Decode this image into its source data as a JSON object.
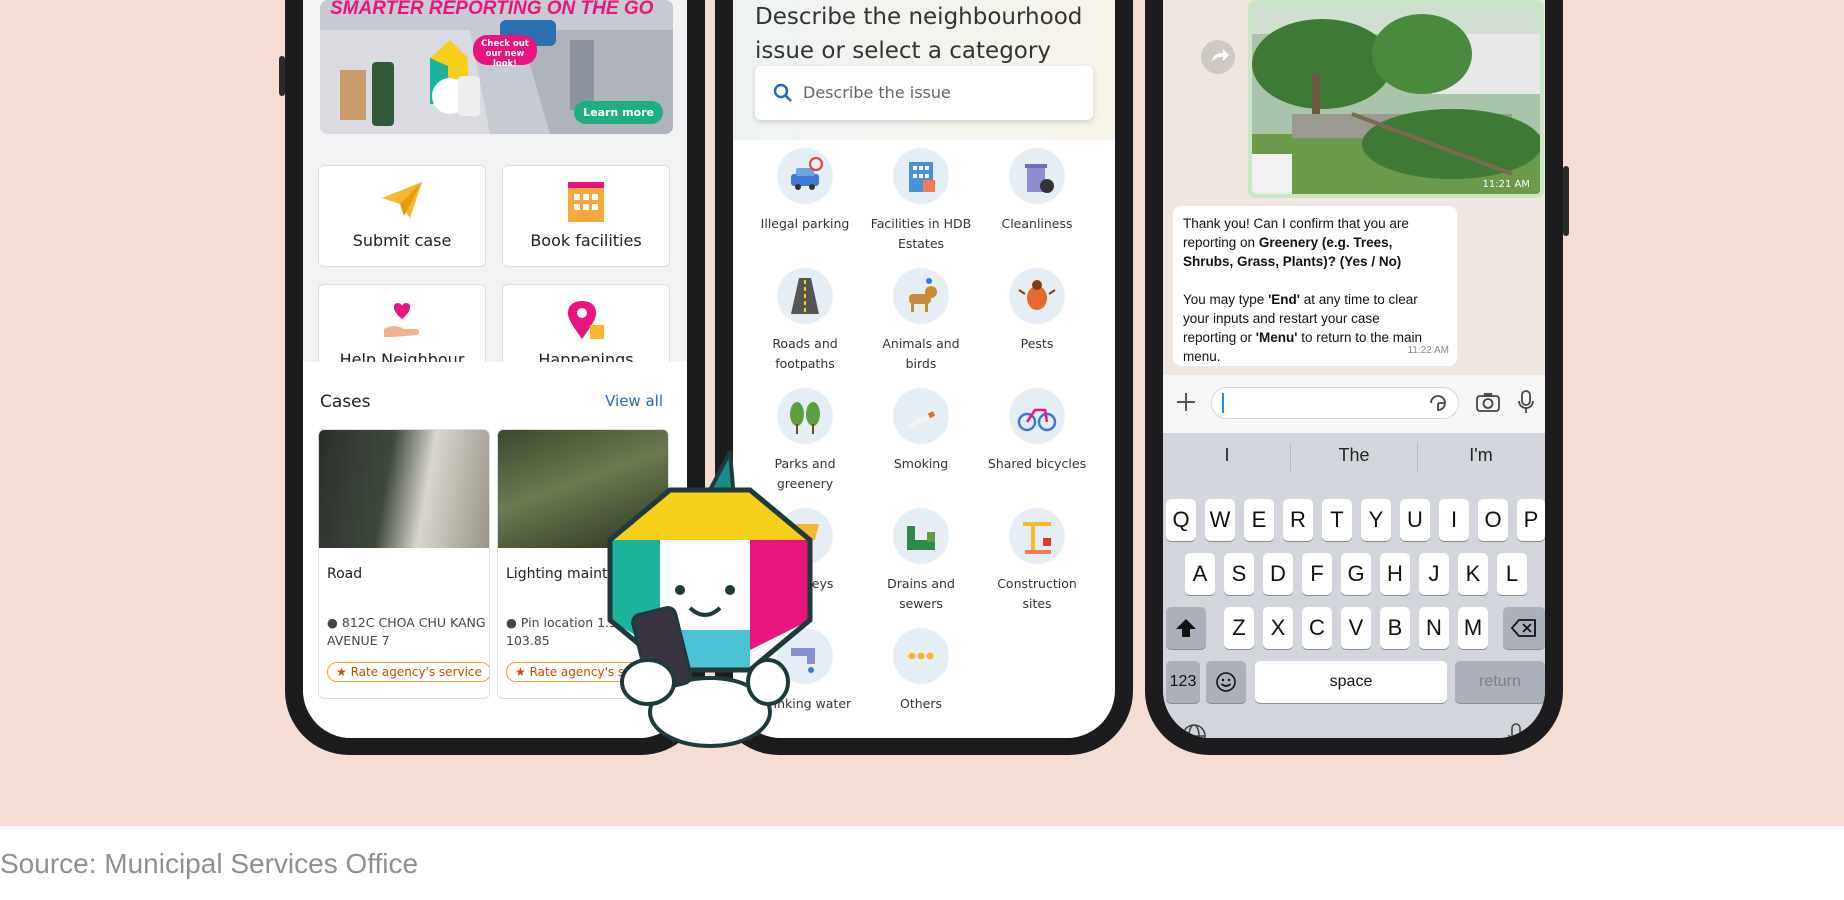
{
  "caption": "Source: Municipal Services Office",
  "phone1": {
    "banner": {
      "title": "SMARTER REPORTING ON THE GO",
      "bubble": "Check out our new look!",
      "button": "Learn more"
    },
    "tiles": [
      {
        "label": "Submit case",
        "icon": "paper-plane-icon"
      },
      {
        "label": "Book facilities",
        "icon": "building-icon"
      },
      {
        "label": "Help Neighbour",
        "icon": "heart-hand-icon"
      },
      {
        "label": "Happenings",
        "icon": "location-pin-icon"
      }
    ],
    "cases": {
      "title": "Cases",
      "view_all": "View all",
      "items": [
        {
          "name": "Road",
          "location": "812C CHOA CHU KANG AVENUE 7",
          "rate": "Rate agency's service"
        },
        {
          "name": "Lighting maint",
          "location": "Pin location 1.36, 103.85",
          "rate": "Rate agency's service"
        }
      ]
    }
  },
  "phone2": {
    "heading": "Describe the neighbourhood issue or select a category",
    "search_placeholder": "Describe the issue",
    "categories": [
      {
        "label": "Illegal parking",
        "icon": "car-icon"
      },
      {
        "label": "Facilities in HDB Estates",
        "icon": "building-icon"
      },
      {
        "label": "Cleanliness",
        "icon": "bin-icon"
      },
      {
        "label": "Roads and footpaths",
        "icon": "road-icon"
      },
      {
        "label": "Animals and birds",
        "icon": "dog-icon"
      },
      {
        "label": "Pests",
        "icon": "bug-icon"
      },
      {
        "label": "Parks and greenery",
        "icon": "tree-icon"
      },
      {
        "label": "Smoking",
        "icon": "cigarette-icon"
      },
      {
        "label": "Shared bicycles",
        "icon": "bicycle-icon"
      },
      {
        "label": "oned eys",
        "icon": "trolley-icon"
      },
      {
        "label": "Drains and sewers",
        "icon": "drain-icon"
      },
      {
        "label": "Construction sites",
        "icon": "crane-icon"
      },
      {
        "label": "Drinking water",
        "icon": "tap-icon"
      },
      {
        "label": "Others",
        "icon": "more-icon"
      }
    ]
  },
  "phone3": {
    "image_time": "11:21 AM",
    "message_lines_1": [
      "Thank you! Can I confirm that you are",
      "reporting on Greenery (e.g. Trees,",
      "Shrubs, Grass, Plants)? (Yes / No)"
    ],
    "message_lines_2": [
      "You may type 'End' at any time to clear",
      "your inputs and restart your case",
      "reporting or 'Menu' to return to the main",
      "menu."
    ],
    "message_time": "11:22 AM",
    "suggestions": [
      "I",
      "The",
      "I'm"
    ],
    "rows": [
      [
        "Q",
        "W",
        "E",
        "R",
        "T",
        "Y",
        "U",
        "I",
        "O",
        "P"
      ],
      [
        "A",
        "S",
        "D",
        "F",
        "G",
        "H",
        "J",
        "K",
        "L"
      ],
      [
        "Z",
        "X",
        "C",
        "V",
        "B",
        "N",
        "M"
      ]
    ],
    "key_123": "123",
    "key_space": "space",
    "key_return": "return"
  }
}
